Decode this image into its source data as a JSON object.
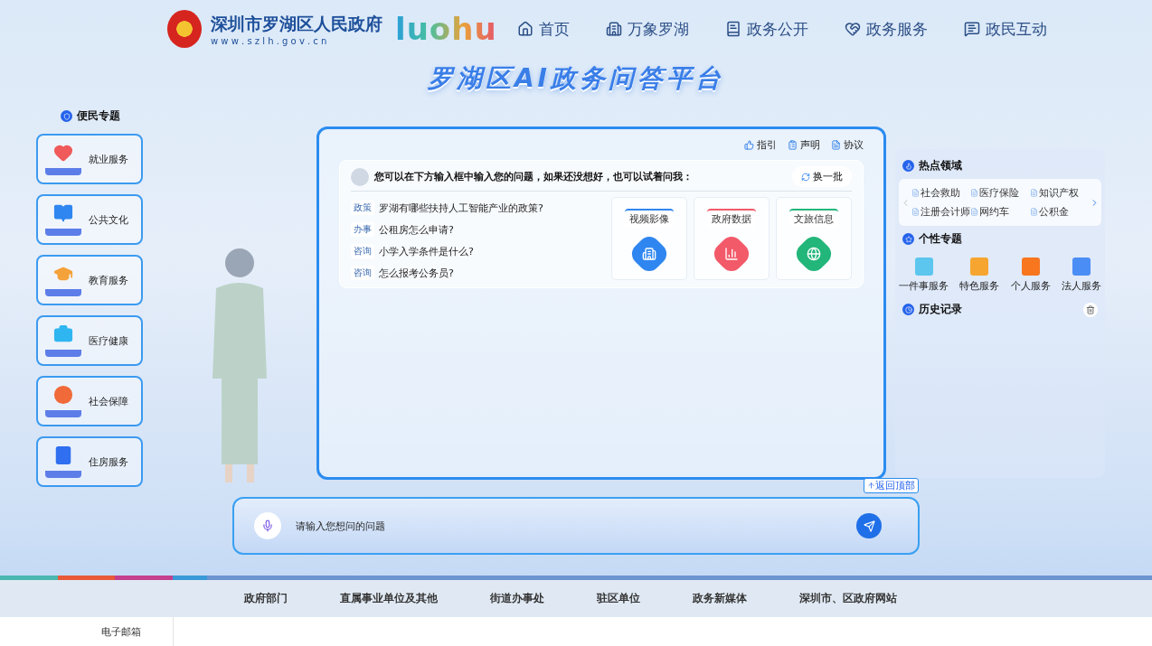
{
  "header": {
    "site_name": "深圳市罗湖区人民政府",
    "site_url": "w w w . s z l h . g o v . c n",
    "brand": "luohu",
    "nav": [
      "首页",
      "万象罗湖",
      "政务公开",
      "政务服务",
      "政民互动"
    ]
  },
  "title": "罗湖区AI政务问答平台",
  "left_panel": {
    "heading": "便民专题",
    "items": [
      {
        "label": "就业服务",
        "color": "#f05a5a"
      },
      {
        "label": "公共文化",
        "color": "#2f86f0"
      },
      {
        "label": "教育服务",
        "color": "#f5a23a"
      },
      {
        "label": "医疗健康",
        "color": "#2fb6f0"
      },
      {
        "label": "社会保障",
        "color": "#f06a3a"
      },
      {
        "label": "住房服务",
        "color": "#2f6ff0"
      }
    ]
  },
  "center": {
    "links": [
      "指引",
      "声明",
      "协议"
    ],
    "prompt": "您可以在下方输入框中输入您的问题，如果还没想好，也可以试着问我：",
    "refresh": "换一批",
    "questions": [
      {
        "tag": "政策",
        "text": "罗湖有哪些扶持人工智能产业的政策?"
      },
      {
        "tag": "办事",
        "text": "公租房怎么申请?"
      },
      {
        "tag": "咨询",
        "text": "小学入学条件是什么?"
      },
      {
        "tag": "咨询",
        "text": "怎么报考公务员?"
      }
    ],
    "cards": [
      {
        "label": "视频影像",
        "color": "#2f86f0"
      },
      {
        "label": "政府数据",
        "color": "#f25a6a"
      },
      {
        "label": "文旅信息",
        "color": "#22b67a"
      }
    ]
  },
  "right_panel": {
    "hot": {
      "heading": "热点领域",
      "items": [
        "社会救助",
        "医疗保险",
        "知识产权",
        "注册会计师",
        "网约车",
        "公积金"
      ]
    },
    "topics": {
      "heading": "个性专题",
      "items": [
        {
          "label": "一件事服务",
          "color": "#5cc6ee"
        },
        {
          "label": "特色服务",
          "color": "#f7a531"
        },
        {
          "label": "个人服务",
          "color": "#f7761e"
        },
        {
          "label": "法人服务",
          "color": "#4a8ef5"
        }
      ]
    },
    "history": {
      "heading": "历史记录"
    }
  },
  "back_to_top": "返回顶部",
  "input": {
    "placeholder": "请输入您想问的问题"
  },
  "footer_nav": [
    "政府部门",
    "直属事业单位及其他",
    "街道办事处",
    "驻区单位",
    "政务新媒体",
    "深圳市、区政府网站"
  ],
  "footer": {
    "email": "电子邮箱"
  }
}
